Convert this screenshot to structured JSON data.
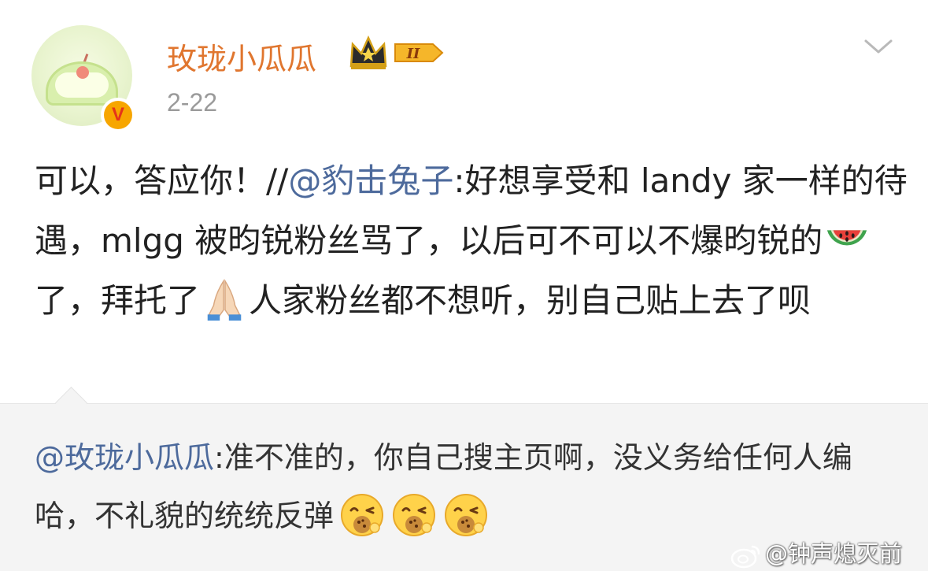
{
  "post": {
    "author": "玫珑小瓜瓜",
    "level_badge": "II",
    "date": "2-22",
    "content": {
      "text_1": "可以，答应你！//",
      "mention": "@豹击兔子",
      "text_2": ":好想享受和 landy 家一样的待遇，mlgg 被昀锐粉丝骂了，以后可不可以不爆昀锐的",
      "emoji_1": "watermelon-icon",
      "text_3": "了，拜托了",
      "emoji_2": "praying-hands-icon",
      "text_4": "人家粉丝都不想听，别自己贴上去了呗"
    }
  },
  "repost": {
    "mention": "@玫珑小瓜瓜",
    "text": ":准不准的，你自己搜主页啊，没义务给任何人编哈，不礼貌的统统反弹",
    "emoji": "cookie-face-icon"
  },
  "watermark": "@钟声熄灭前",
  "colors": {
    "username": "#e0762f",
    "mention": "#4d6a9c",
    "repost_bg": "#f4f4f4",
    "date": "#9a9a9a"
  }
}
